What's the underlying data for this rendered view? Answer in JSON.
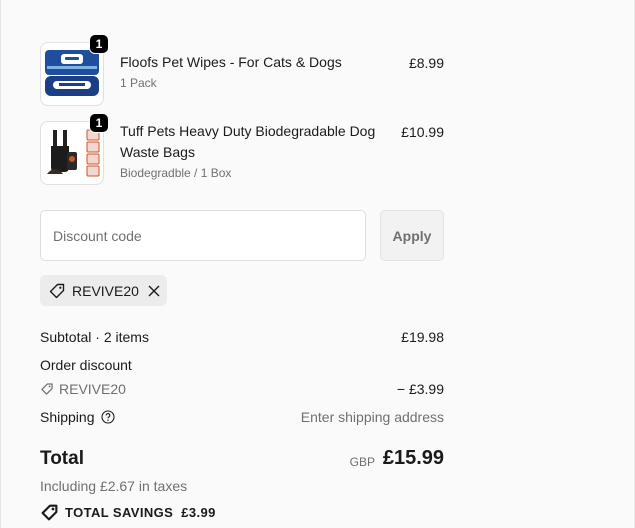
{
  "items": [
    {
      "title": "Floofs Pet Wipes - For Cats & Dogs",
      "title_line2": "",
      "variant": "1 Pack",
      "price": "£8.99",
      "quantity": "1"
    },
    {
      "title": "Tuff Pets Heavy Duty Biodegradable Dog",
      "title_line2": "Waste Bags",
      "variant": "Biodegradble / 1 Box",
      "price": "£10.99",
      "quantity": "1"
    }
  ],
  "discount": {
    "placeholder": "Discount code",
    "value": "",
    "apply_label": "Apply",
    "applied_code": "REVIVE20"
  },
  "summary": {
    "subtotal_label": "Subtotal · 2 items",
    "subtotal_value": "£19.98",
    "order_discount_label": "Order discount",
    "discount_code": "REVIVE20",
    "discount_value": "− £3.99",
    "shipping_label": "Shipping",
    "shipping_value": "Enter shipping address",
    "total_label": "Total",
    "currency": "GBP",
    "total_value": "£15.99",
    "taxes_note": "Including £2.67 in taxes",
    "savings_label": "TOTAL SAVINGS",
    "savings_value": "£3.99"
  },
  "colors": {
    "background": "#fafafa",
    "text": "#1a1a1a",
    "muted": "#707070",
    "badge": "#000000",
    "chip": "#ececec",
    "wipes_blue": "#1f4f9c"
  },
  "icons": [
    "tag-icon",
    "close-icon",
    "help-circle-icon",
    "savings-tag-icon"
  ]
}
